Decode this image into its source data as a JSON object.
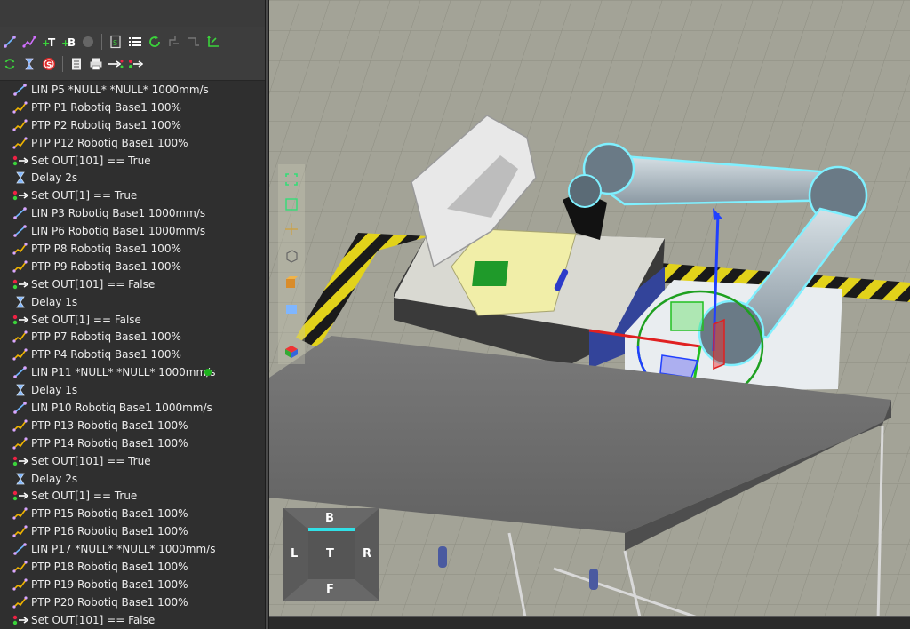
{
  "toolbar": {
    "row1": [
      "lin-icon",
      "ptp-icon",
      "tool-t-icon",
      "base-b-icon",
      "record-icon",
      "sub-program-icon",
      "list-icon",
      "loop-icon",
      "teach-icon",
      "reteach-icon",
      "frame-icon"
    ],
    "row2": [
      "refresh-icon",
      "delay-icon",
      "stop-icon",
      "document-icon",
      "print-icon",
      "io-out-icon",
      "io-set-icon"
    ]
  },
  "program": {
    "lines": [
      {
        "type": "lin",
        "label": "LIN P5 *NULL* *NULL* 1000mm/s"
      },
      {
        "type": "ptp",
        "label": "PTP P1 Robotiq Base1 100%"
      },
      {
        "type": "ptp",
        "label": "PTP P2 Robotiq Base1 100%"
      },
      {
        "type": "ptp",
        "label": "PTP P12 Robotiq Base1 100%"
      },
      {
        "type": "out",
        "label": "Set OUT[101] == True"
      },
      {
        "type": "delay",
        "label": "Delay 2s"
      },
      {
        "type": "out",
        "label": "Set OUT[1] == True"
      },
      {
        "type": "lin",
        "label": "LIN P3 Robotiq Base1 1000mm/s"
      },
      {
        "type": "lin",
        "label": "LIN P6 Robotiq Base1 1000mm/s"
      },
      {
        "type": "ptp",
        "label": "PTP P8 Robotiq Base1 100%"
      },
      {
        "type": "ptp",
        "label": "PTP P9 Robotiq Base1 100%"
      },
      {
        "type": "out",
        "label": "Set OUT[101] == False"
      },
      {
        "type": "delay",
        "label": "Delay 1s"
      },
      {
        "type": "out",
        "label": "Set OUT[1] == False"
      },
      {
        "type": "ptp",
        "label": "PTP P7 Robotiq Base1 100%"
      },
      {
        "type": "ptp",
        "label": "PTP P4 Robotiq Base1 100%"
      },
      {
        "type": "lin",
        "label": "LIN P11 *NULL* *NULL* 1000mm/s",
        "active": true
      },
      {
        "type": "delay",
        "label": "Delay 1s"
      },
      {
        "type": "lin",
        "label": "LIN P10 Robotiq Base1 1000mm/s"
      },
      {
        "type": "ptp",
        "label": "PTP P13 Robotiq Base1 100%"
      },
      {
        "type": "ptp",
        "label": "PTP P14 Robotiq Base1 100%"
      },
      {
        "type": "out",
        "label": "Set OUT[101] == True"
      },
      {
        "type": "delay",
        "label": "Delay 2s"
      },
      {
        "type": "out",
        "label": "Set OUT[1] == True"
      },
      {
        "type": "ptp",
        "label": "PTP P15 Robotiq Base1 100%"
      },
      {
        "type": "ptp",
        "label": "PTP P16 Robotiq Base1 100%"
      },
      {
        "type": "lin",
        "label": "LIN P17 *NULL* *NULL* 1000mm/s"
      },
      {
        "type": "ptp",
        "label": "PTP P18 Robotiq Base1 100%"
      },
      {
        "type": "ptp",
        "label": "PTP P19 Robotiq Base1 100%"
      },
      {
        "type": "ptp",
        "label": "PTP P20 Robotiq Base1 100%"
      },
      {
        "type": "out",
        "label": "Set OUT[101] == False"
      }
    ]
  },
  "nav_cube": {
    "top": "B",
    "left": "L",
    "center": "T",
    "right": "R",
    "bottom": "F"
  },
  "colors": {
    "active_dot": "#1db21d",
    "robot_highlight": "#7ff0ff",
    "axis_x": "#e02020",
    "axis_y": "#20c020",
    "axis_z": "#2040ff"
  }
}
